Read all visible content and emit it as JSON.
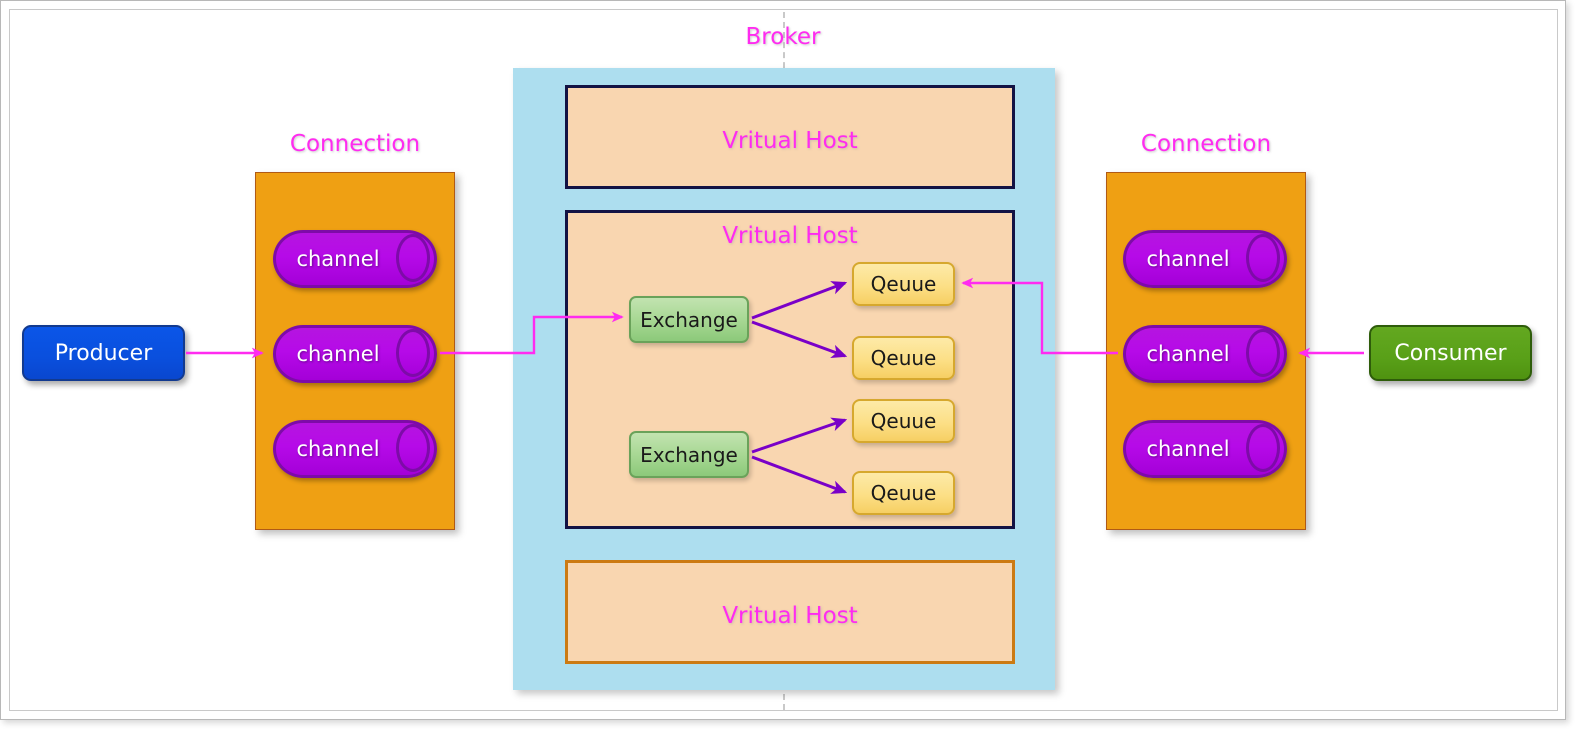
{
  "diagram": {
    "title": "Broker",
    "colors": {
      "magenta_label": "#ff2bf0",
      "broker_fill": "#addeef",
      "vhost_fill": "#f9d6b0",
      "vhost_border_dark": "#131344",
      "vhost_border_orange": "#cc7a12",
      "connection_fill": "#efa013",
      "channel_fill": "#b60ae8",
      "producer_fill": "#0b56e8",
      "consumer_fill": "#63a820",
      "exchange_fill": "#a8d894",
      "queue_fill": "#fcdf86",
      "magenta_arrow": "#ff2bf0",
      "purple_arrow": "#7a00c8"
    }
  },
  "producer": {
    "label": "Producer"
  },
  "consumer": {
    "label": "Consumer"
  },
  "left_connection": {
    "title": "Connection",
    "channels": [
      {
        "label": "channel"
      },
      {
        "label": "channel"
      },
      {
        "label": "channel"
      }
    ]
  },
  "right_connection": {
    "title": "Connection",
    "channels": [
      {
        "label": "channel"
      },
      {
        "label": "channel"
      },
      {
        "label": "channel"
      }
    ]
  },
  "broker": {
    "label": "Broker",
    "vhosts": [
      {
        "title": "Vritual Host",
        "border": "dark"
      },
      {
        "title": "Vritual Host",
        "border": "dark"
      },
      {
        "title": "Vritual Host",
        "border": "orange"
      }
    ],
    "exchanges": [
      {
        "label": "Exchange"
      },
      {
        "label": "Exchange"
      }
    ],
    "queues": [
      {
        "label": "Qeuue"
      },
      {
        "label": "Qeuue"
      },
      {
        "label": "Qeuue"
      },
      {
        "label": "Qeuue"
      }
    ]
  },
  "chart_data": {
    "type": "diagram",
    "title": "Broker",
    "nodes": [
      {
        "id": "producer",
        "label": "Producer",
        "type": "endpoint"
      },
      {
        "id": "left-connection",
        "label": "Connection",
        "type": "container"
      },
      {
        "id": "left-channel-1",
        "label": "channel",
        "type": "cylinder"
      },
      {
        "id": "left-channel-2",
        "label": "channel",
        "type": "cylinder"
      },
      {
        "id": "left-channel-3",
        "label": "channel",
        "type": "cylinder"
      },
      {
        "id": "broker",
        "label": "Broker",
        "type": "container"
      },
      {
        "id": "vhost-1",
        "label": "Vritual Host",
        "type": "container"
      },
      {
        "id": "vhost-2",
        "label": "Vritual Host",
        "type": "container"
      },
      {
        "id": "vhost-3",
        "label": "Vritual Host",
        "type": "container"
      },
      {
        "id": "exchange-1",
        "label": "Exchange",
        "type": "box"
      },
      {
        "id": "exchange-2",
        "label": "Exchange",
        "type": "box"
      },
      {
        "id": "queue-1",
        "label": "Qeuue",
        "type": "box"
      },
      {
        "id": "queue-2",
        "label": "Qeuue",
        "type": "box"
      },
      {
        "id": "queue-3",
        "label": "Qeuue",
        "type": "box"
      },
      {
        "id": "queue-4",
        "label": "Qeuue",
        "type": "box"
      },
      {
        "id": "right-connection",
        "label": "Connection",
        "type": "container"
      },
      {
        "id": "right-channel-1",
        "label": "channel",
        "type": "cylinder"
      },
      {
        "id": "right-channel-2",
        "label": "channel",
        "type": "cylinder"
      },
      {
        "id": "right-channel-3",
        "label": "channel",
        "type": "cylinder"
      },
      {
        "id": "consumer",
        "label": "Consumer",
        "type": "endpoint"
      }
    ],
    "edges": [
      {
        "from": "producer",
        "to": "left-channel-2",
        "color": "#ff2bf0"
      },
      {
        "from": "left-channel-2",
        "to": "exchange-1",
        "color": "#ff2bf0"
      },
      {
        "from": "exchange-1",
        "to": "queue-1",
        "color": "#7a00c8"
      },
      {
        "from": "exchange-1",
        "to": "queue-2",
        "color": "#7a00c8"
      },
      {
        "from": "exchange-2",
        "to": "queue-3",
        "color": "#7a00c8"
      },
      {
        "from": "exchange-2",
        "to": "queue-4",
        "color": "#7a00c8"
      },
      {
        "from": "queue-1",
        "to": "right-channel-2",
        "color": "#ff2bf0",
        "direction": "to-queue"
      },
      {
        "from": "consumer",
        "to": "right-channel-2",
        "color": "#ff2bf0"
      }
    ]
  }
}
